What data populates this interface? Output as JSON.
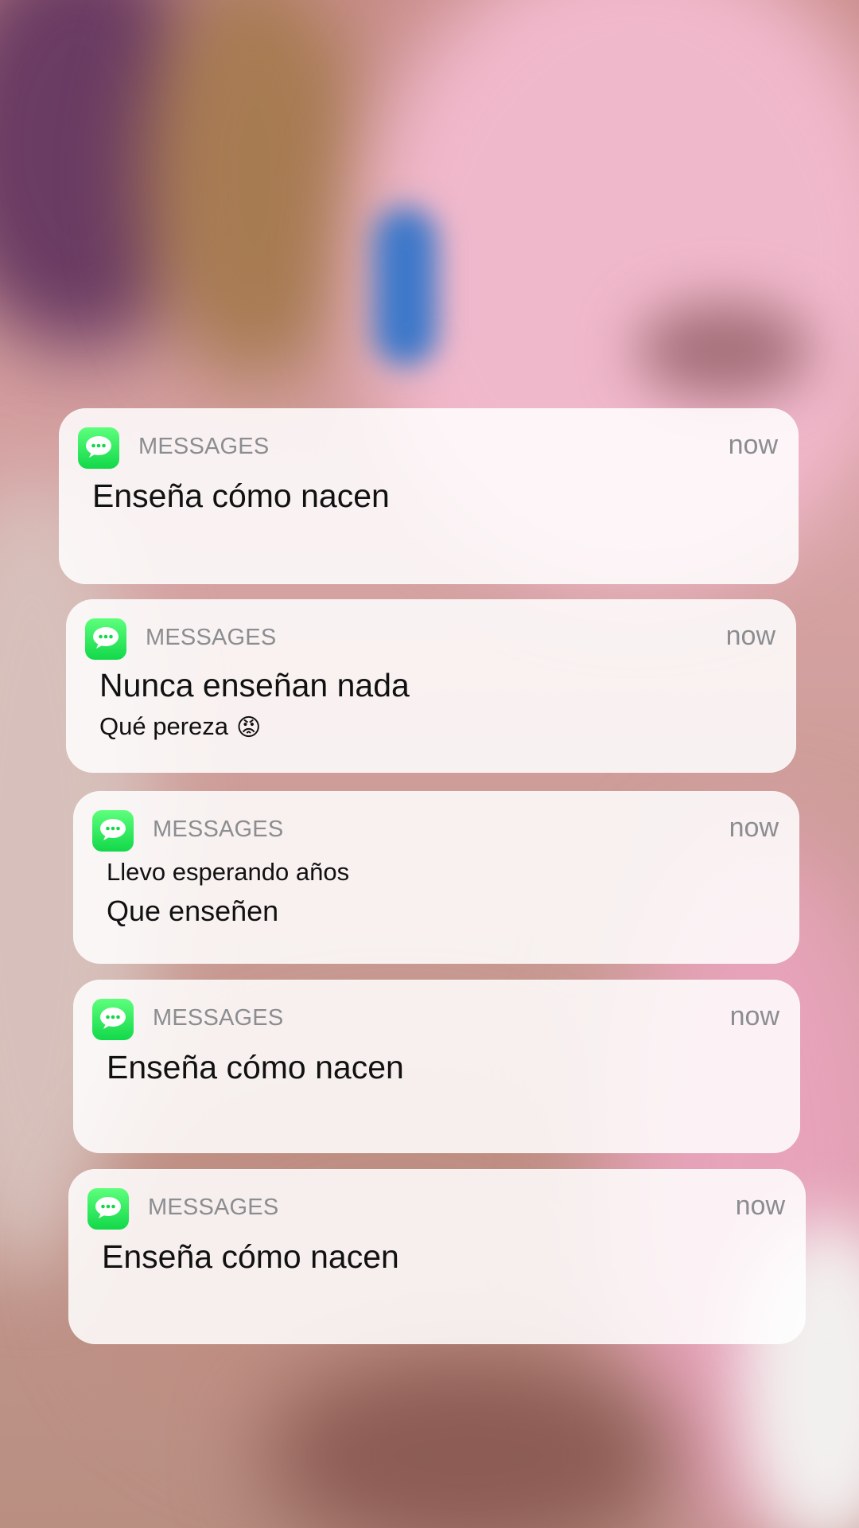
{
  "notifications": [
    {
      "app": "MESSAGES",
      "time": "now",
      "line1": "Enseña cómo nacen"
    },
    {
      "app": "MESSAGES",
      "time": "now",
      "line1": "Nunca enseñan nada",
      "line2": "Qué pereza",
      "emoji": "😡"
    },
    {
      "app": "MESSAGES",
      "time": "now",
      "line1": "Llevo esperando años",
      "line2": "Que enseñen"
    },
    {
      "app": "MESSAGES",
      "time": "now",
      "line1": "Enseña cómo nacen"
    },
    {
      "app": "MESSAGES",
      "time": "now",
      "line1": "Enseña cómo nacen"
    }
  ],
  "icons": {
    "app_icon": "messages-icon"
  }
}
